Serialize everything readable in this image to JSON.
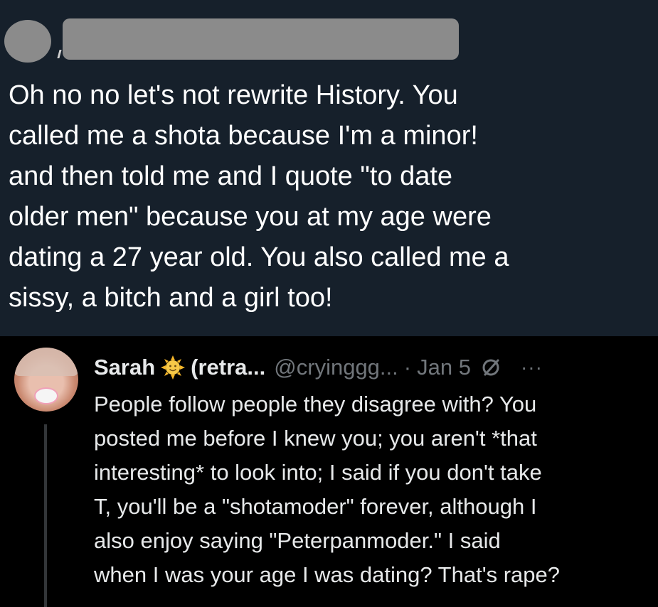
{
  "quoted_post": {
    "text": "Oh no no let's not rewrite History. You\ncalled me a shota because I'm a minor!\nand then told me and I quote \"to date\nolder men\" because you at my age were\ndating a 27 year old. You also called me a\nsissy, a bitch and a girl too!"
  },
  "reply": {
    "display_name": "Sarah",
    "display_name_suffix": "(retra...",
    "handle": "@cryinggg...",
    "separator": "·",
    "date": "Jan 5",
    "more": "···",
    "text": "People follow people they disagree with? You\nposted me before I knew you; you aren't *that\ninteresting* to look into; I said if you don't take\nT, you'll be a \"shotamoder\" forever, although I\nalso enjoy saying \"Peterpanmoder.\" I said\nwhen I was your age I was dating? That's rape?"
  },
  "icons": {
    "name_emoji": "sun-face-icon",
    "edited": "edited-icon",
    "more": "more-options-icon"
  },
  "colors": {
    "top_background": "#16202b",
    "bottom_background": "#000000",
    "primary_text": "#e7e9ea",
    "secondary_text": "#71767b",
    "redaction": "#8b8b8b"
  }
}
